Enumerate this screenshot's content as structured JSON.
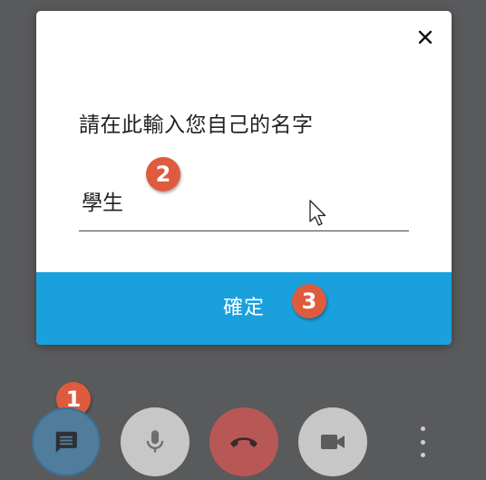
{
  "dialog": {
    "prompt": "請在此輸入您自己的名字",
    "name_value": "學生",
    "confirm_label": "確定"
  },
  "badges": {
    "step1": "1",
    "step2": "2",
    "step3": "3"
  },
  "colors": {
    "background": "#595a5c",
    "confirm_button": "#1aa0dc",
    "badge": "#de5c3d",
    "chat_button": "#4f7d9b",
    "hangup_button": "#b85856",
    "neutral_button": "#c7c7c7"
  },
  "toolbar": {
    "icons": [
      "chat-icon",
      "microphone-icon",
      "phone-hangup-icon",
      "video-camera-icon",
      "more-vertical-icon"
    ]
  }
}
